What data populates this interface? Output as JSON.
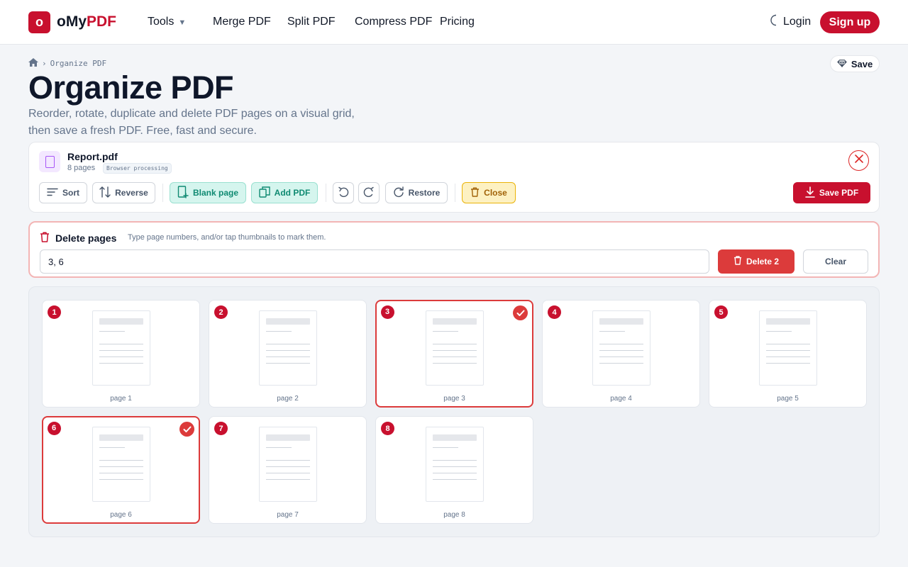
{
  "header": {
    "logo_letter": "o",
    "logo_text_prefix": "oMy",
    "logo_text_accent": "PDF",
    "nav": {
      "tools": "Tools",
      "merge": "Merge PDF",
      "split": "Split PDF",
      "compress": "Compress PDF",
      "pricing": "Pricing"
    },
    "login": "Login",
    "signup": "Sign up"
  },
  "breadcrumb": {
    "current": "Organize PDF"
  },
  "page": {
    "title": "Organize PDF",
    "subtitle_line1": "Reorder, rotate, duplicate and delete PDF pages on a visual grid,",
    "subtitle_line2": "then save a fresh PDF. Free, fast and secure.",
    "save_label": "Save"
  },
  "file": {
    "name": "Report.pdf",
    "pages": "8 pages",
    "badge": "Browser processing"
  },
  "toolbar": {
    "sort": "Sort",
    "reverse": "Reverse",
    "blank_page": "Blank page",
    "add_pdf": "Add PDF",
    "restore": "Restore",
    "close": "Close",
    "save_pdf": "Save PDF"
  },
  "delete_panel": {
    "title": "Delete pages",
    "hint": "Type page numbers, and/or tap thumbnails to mark them.",
    "input_value": "3, 6",
    "delete_button": "Delete 2",
    "clear_button": "Clear"
  },
  "pages": [
    {
      "num": "1",
      "label": "page 1",
      "selected": false
    },
    {
      "num": "2",
      "label": "page 2",
      "selected": false
    },
    {
      "num": "3",
      "label": "page 3",
      "selected": true
    },
    {
      "num": "4",
      "label": "page 4",
      "selected": false
    },
    {
      "num": "5",
      "label": "page 5",
      "selected": false
    },
    {
      "num": "6",
      "label": "page 6",
      "selected": true
    },
    {
      "num": "7",
      "label": "page 7",
      "selected": false
    },
    {
      "num": "8",
      "label": "page 8",
      "selected": false
    }
  ],
  "colors": {
    "brand": "#c8102e",
    "danger": "#dc3b3b",
    "teal": "#0f8a72",
    "warning": "#a16207"
  },
  "icons": {
    "home": "home-icon",
    "moon": "moon-icon",
    "save": "diamond-icon",
    "file": "document-icon",
    "close": "close-icon",
    "sort": "sort-lines-icon",
    "reverse": "arrows-up-down-icon",
    "blank_page": "blank-page-icon",
    "add_pdf": "copy-icon",
    "rotate_left": "rotate-left-icon",
    "rotate_right": "rotate-right-icon",
    "restore": "restore-icon",
    "trash": "trash-icon",
    "download": "download-icon",
    "check": "check-icon"
  }
}
